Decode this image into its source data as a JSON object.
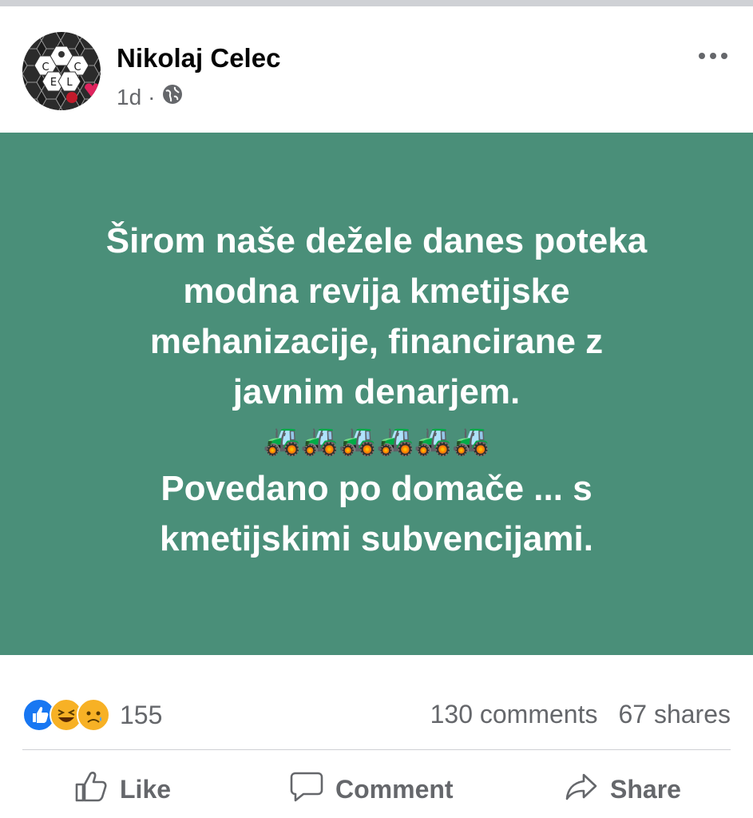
{
  "post": {
    "author": "Nikolaj Celec",
    "time": "1d",
    "separator": "·",
    "privacy_icon": "globe-icon",
    "more_icon": "more-dots-icon",
    "avatar": {
      "letters": [
        "C",
        "C",
        "E",
        "L",
        "E"
      ],
      "icons": [
        "hexagon-pattern",
        "red-heart",
        "bee-icon"
      ]
    },
    "background_color": "#4a8f79",
    "text_lines": [
      "Širom naše dežele danes poteka",
      "modna revija kmetijske",
      "mehanizacije, financirane z",
      "javnim denarjem."
    ],
    "emoji_line": "🚜🚜🚜🚜🚜🚜",
    "text_lines_after": [
      "Povedano po domače ... s",
      "kmetijskimi subvencijami."
    ]
  },
  "stats": {
    "reaction_icons": [
      "like-reaction-icon",
      "haha-reaction-icon",
      "sad-reaction-icon"
    ],
    "reaction_count": "155",
    "comments": "130 comments",
    "shares": "67 shares"
  },
  "actions": {
    "like": "Like",
    "comment": "Comment",
    "share": "Share"
  }
}
